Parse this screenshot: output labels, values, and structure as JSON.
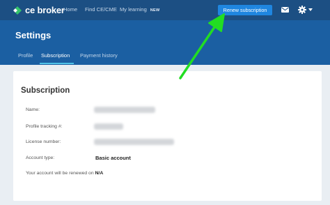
{
  "brand": {
    "name": "ce broker",
    "logo_icon": "ce-broker-logo"
  },
  "nav": {
    "links": [
      "Home",
      "Find CE/CME",
      "My learning"
    ],
    "new_badge": "NEW",
    "renew_button": "Renew subscription",
    "icons": [
      "mail-icon",
      "gear-icon",
      "chevron-down-icon"
    ]
  },
  "header": {
    "title": "Settings",
    "tabs": [
      "Profile",
      "Subscription",
      "Payment history"
    ],
    "active_tab": "Subscription"
  },
  "subscription": {
    "title": "Subscription",
    "name_label": "Name:",
    "tracking_label": "Profile tracking #:",
    "license_label": "License number:",
    "account_type_label": "Account type:",
    "account_type_value": "Basic account",
    "renewal_text": "Your account will be renewed on",
    "renewal_value": "N/A"
  },
  "colors": {
    "topnav": "#1c4f83",
    "header": "#1b5fa2",
    "accent": "#1f86e0",
    "tab_underline": "#4fc3e8",
    "annotation_arrow": "#22dd22"
  }
}
